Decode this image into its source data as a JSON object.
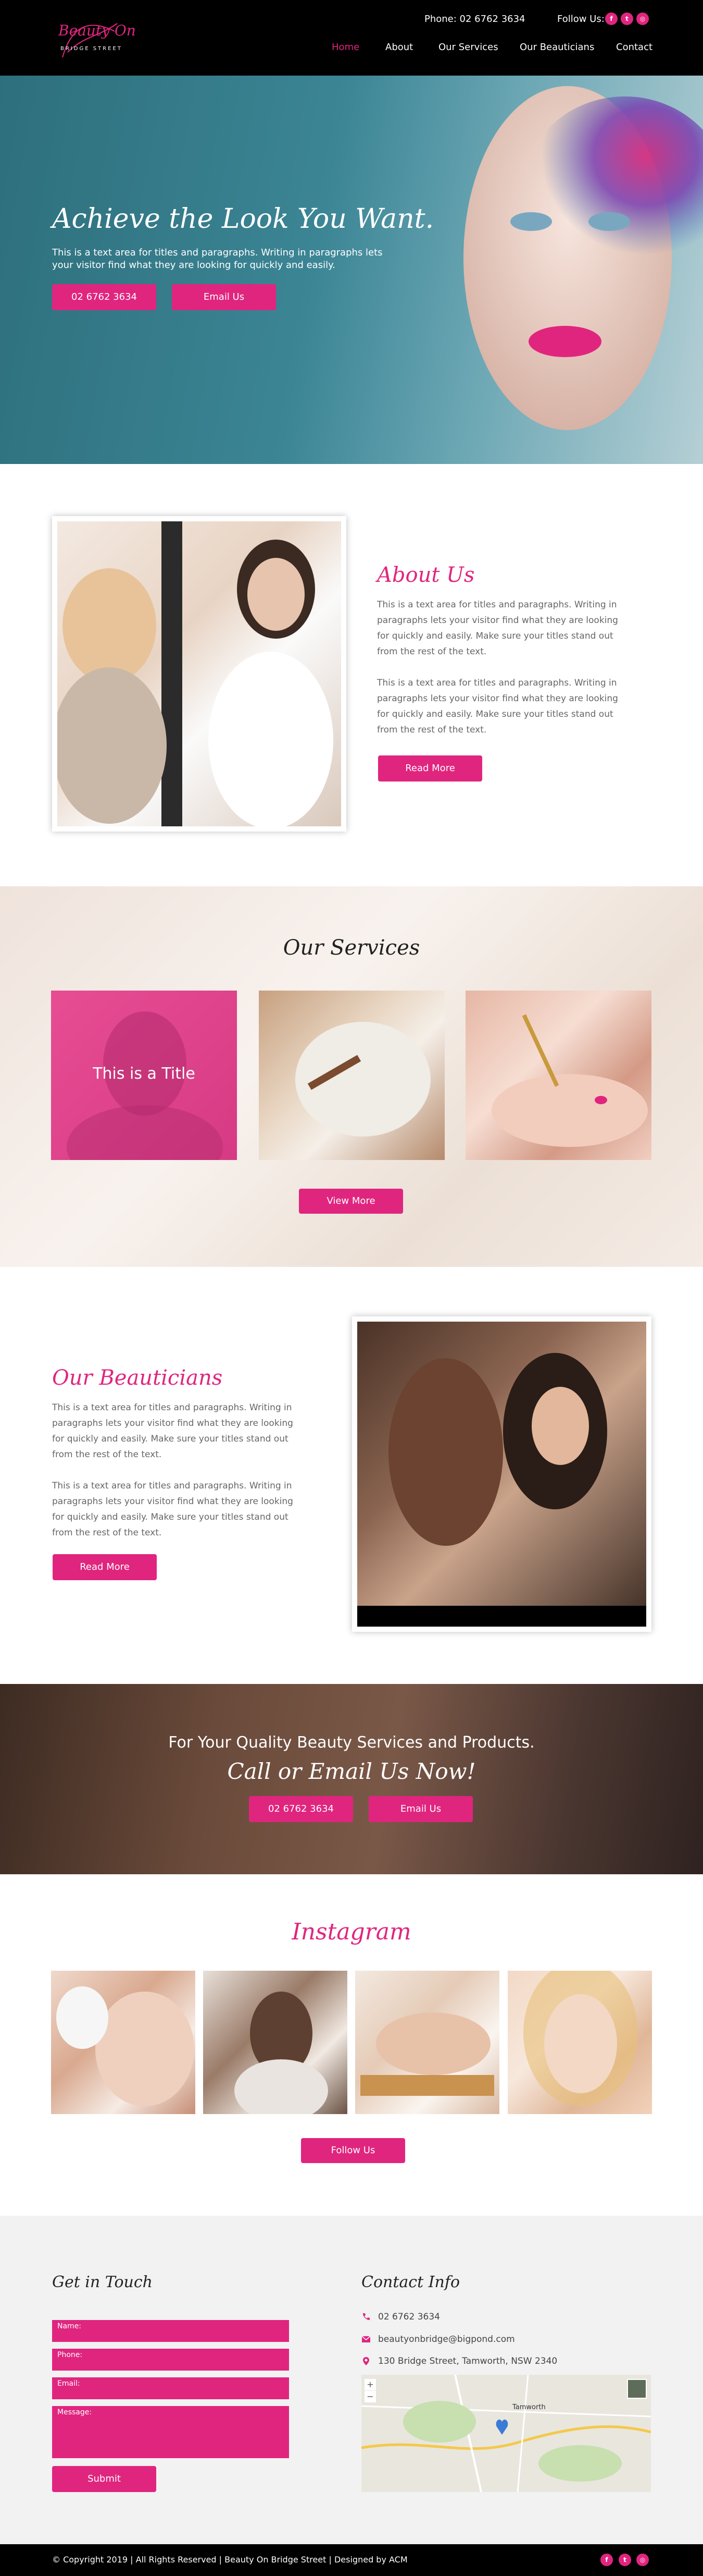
{
  "header": {
    "logo_line1": "Beauty On",
    "logo_line2": "BRIDGE STREET",
    "phone": "Phone: 02 6762 3634",
    "follow": "Follow Us:",
    "nav": [
      "Home",
      "About",
      "Our Services",
      "Our Beauticians",
      "Contact"
    ]
  },
  "hero": {
    "title": "Achieve the Look You Want.",
    "text": "This is a text area for titles and paragraphs. Writing in paragraphs lets your visitor find what they are looking for quickly and easily.",
    "phone_button": "02 6762 3634",
    "email_button": "Email Us"
  },
  "about": {
    "title": "About Us",
    "p1": "This is a text area for titles and paragraphs. Writing in paragraphs lets your visitor find what they are looking for quickly and easily. Make sure your titles stand out from the rest of the text.",
    "p2": "This is a text area for titles and paragraphs. Writing in paragraphs lets your visitor find what they are looking for quickly and easily. Make sure your titles stand out from the rest of the text.",
    "button": "Read More"
  },
  "services": {
    "title": "Our Services",
    "card1_label": "This is a Title",
    "button": "View More"
  },
  "beauticians": {
    "title": "Our Beauticians",
    "p1": "This is a text area for titles and paragraphs. Writing in paragraphs lets your visitor find what they are looking for quickly and easily. Make sure your titles stand out from the rest of the text.",
    "p2": "This is a text area for titles and paragraphs. Writing in paragraphs lets your visitor find what they are looking for quickly and easily. Make sure your titles stand out from the rest of the text.",
    "button": "Read More"
  },
  "cta": {
    "title": "For Your Quality Beauty Services and Products.",
    "subtitle": "Call or Email Us Now!",
    "phone_button": "02 6762 3634",
    "email_button": "Email Us"
  },
  "instagram": {
    "title": "Instagram",
    "button": "Follow Us"
  },
  "contact": {
    "form_title": "Get in Touch",
    "name_placeholder": "Name:",
    "phone_placeholder": "Phone:",
    "email_placeholder": "Email:",
    "message_placeholder": "Message:",
    "submit": "Submit",
    "info_title": "Contact Info",
    "phone": "02 6762 3634",
    "email": "beautyonbridge@bigpond.com",
    "address": "130 Bridge Street, Tamworth, NSW 2340",
    "map_city": "Tamworth"
  },
  "footer": {
    "copyright": "© Copyright 2019 | All Rights Reserved | Beauty On Bridge Street | Designed by ACM"
  },
  "colors": {
    "accent": "#e0257f",
    "header_bg": "#000000",
    "hero_bg": "#3b8595"
  },
  "icons": [
    "facebook-icon",
    "twitter-icon",
    "instagram-icon",
    "phone-icon",
    "envelope-icon",
    "map-pin-icon"
  ]
}
